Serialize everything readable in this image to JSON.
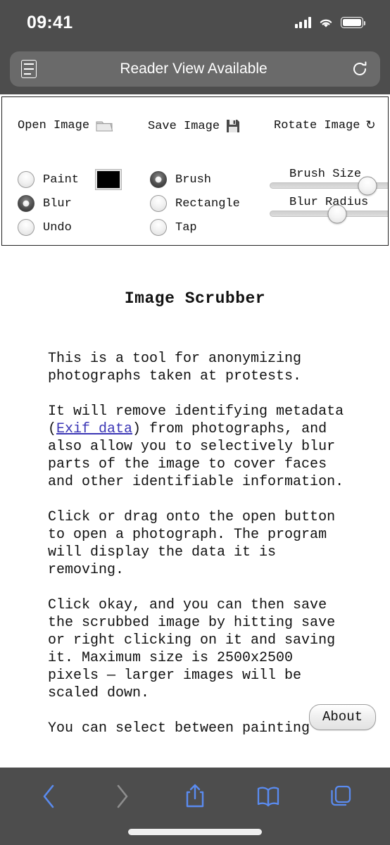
{
  "status_bar": {
    "time": "09:41",
    "cellular_icon": "signal-bars-icon",
    "wifi_icon": "wifi-icon",
    "battery_icon": "battery-full-icon"
  },
  "browser": {
    "url_bar": {
      "reader_icon": "reader-view-icon",
      "title": "Reader View Available",
      "reload_icon": "reload-icon"
    },
    "bottom_toolbar": {
      "back_label": "Back",
      "forward_label": "Forward",
      "share_label": "Share",
      "bookmarks_label": "Bookmarks",
      "tabs_label": "Tabs",
      "back_enabled": true,
      "forward_enabled": false,
      "accent_color": "#5a8bef",
      "disabled_color": "#8e8e8e"
    }
  },
  "toolbar": {
    "open_image_label": "Open Image",
    "open_image_icon": "folder-icon",
    "save_image_label": "Save Image",
    "save_image_icon": "floppy-disk-icon",
    "rotate_image_label": "Rotate Image",
    "rotate_image_icon": "rotate-icon",
    "rotate_glyph": "↻",
    "mode_options": [
      {
        "label": "Paint",
        "checked": false
      },
      {
        "label": "Blur",
        "checked": true
      },
      {
        "label": "Undo",
        "checked": false
      }
    ],
    "paint_color": "#000000",
    "tool_options": [
      {
        "label": "Brush",
        "checked": true
      },
      {
        "label": "Rectangle",
        "checked": false
      },
      {
        "label": "Tap",
        "checked": false
      }
    ],
    "sliders": [
      {
        "label": "Brush Size",
        "value_percent": 48
      },
      {
        "label": "Blur Radius",
        "value_percent": 33
      }
    ]
  },
  "article": {
    "title": "Image Scrubber",
    "paragraph_1": "This is a tool for anonymizing photographs taken at protests.",
    "paragraph_2_before": "It will remove identifying metadata (",
    "paragraph_2_link": "Exif data",
    "paragraph_2_after": ") from photographs, and also allow you to selectively blur parts of the image to cover faces and other identifiable information.",
    "paragraph_3": "Click or drag onto the open button to open a photograph. The program will display the data it is removing.",
    "paragraph_4": "Click okay, and you can then save the scrubbed image by hitting save or right clicking on it and saving it. Maximum size is 2500x2500 pixels — larger images will be scaled down.",
    "paragraph_5": "You can select between painting",
    "about_button_label": "About",
    "link_color": "#3b36b5"
  }
}
